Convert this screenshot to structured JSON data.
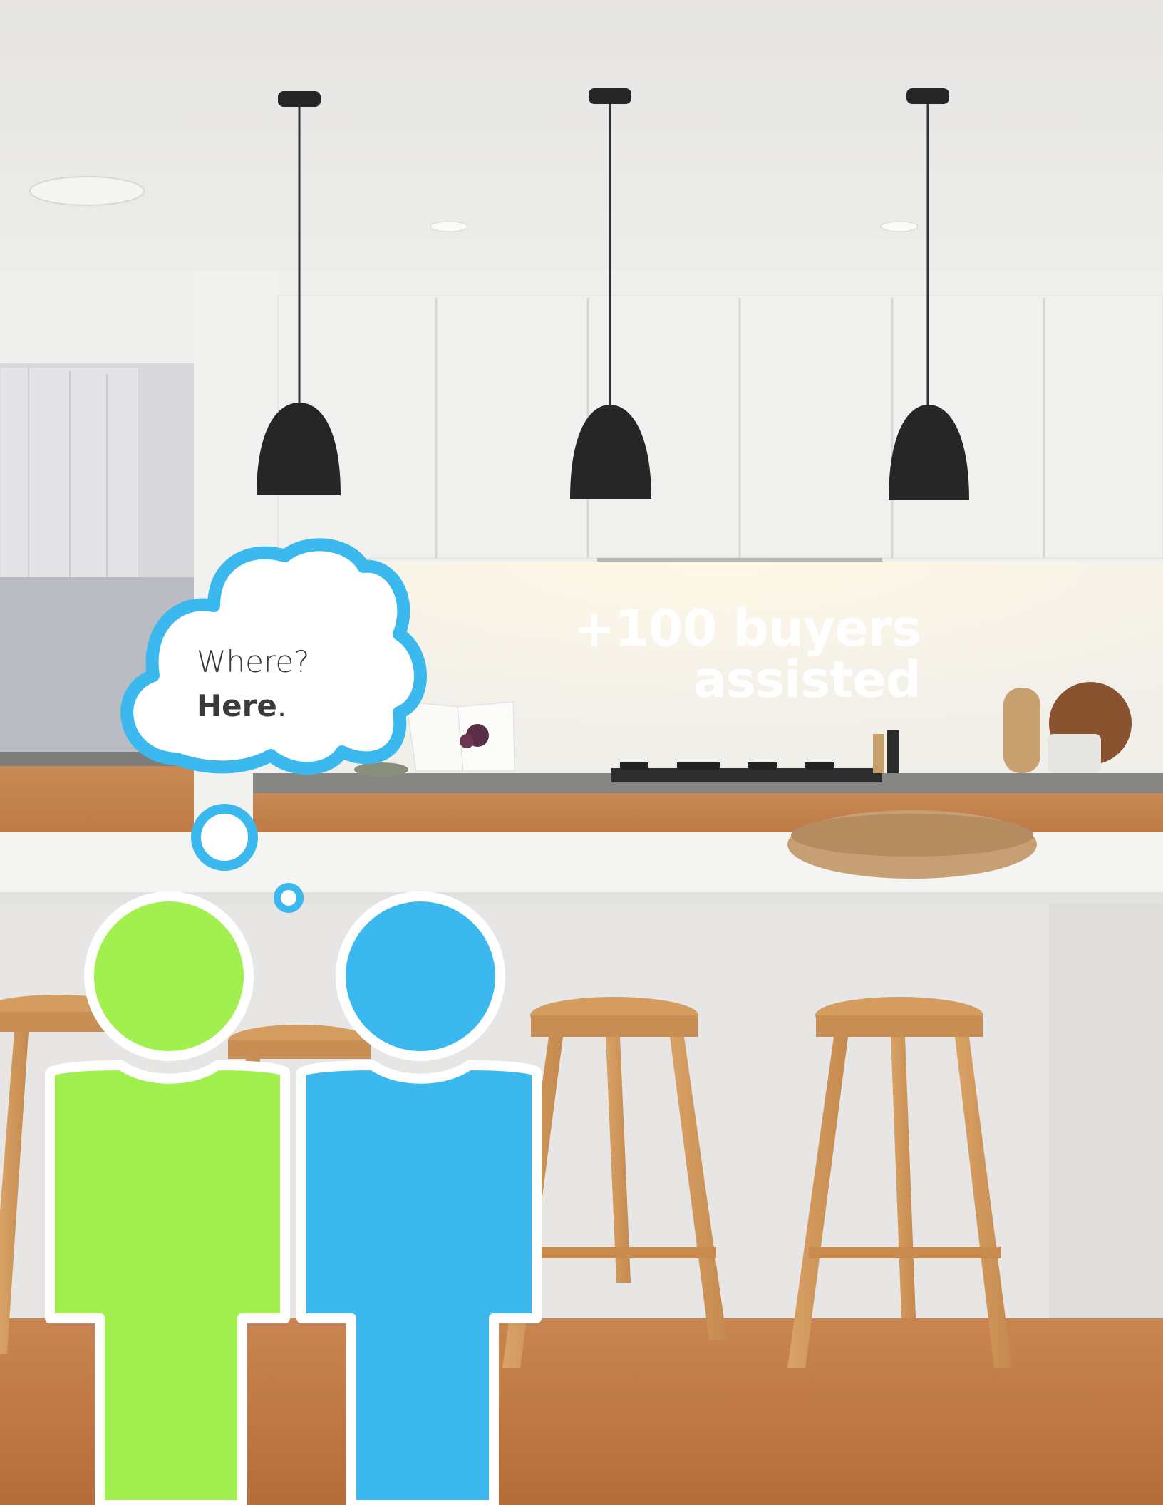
{
  "headline": {
    "line1": "+100 buyers",
    "line2": "assisted"
  },
  "bubble": {
    "question": "Where?",
    "answer": "Here",
    "answer_punct": "."
  },
  "colors": {
    "green": "#a2f04f",
    "blue": "#3bb8ee",
    "bubble_outline": "#3bb8ee",
    "figure_outline": "#ffffff"
  },
  "figures": [
    {
      "color_name": "green"
    },
    {
      "color_name": "blue"
    }
  ],
  "icons": [
    "thought-bubble-icon",
    "person-icon"
  ]
}
